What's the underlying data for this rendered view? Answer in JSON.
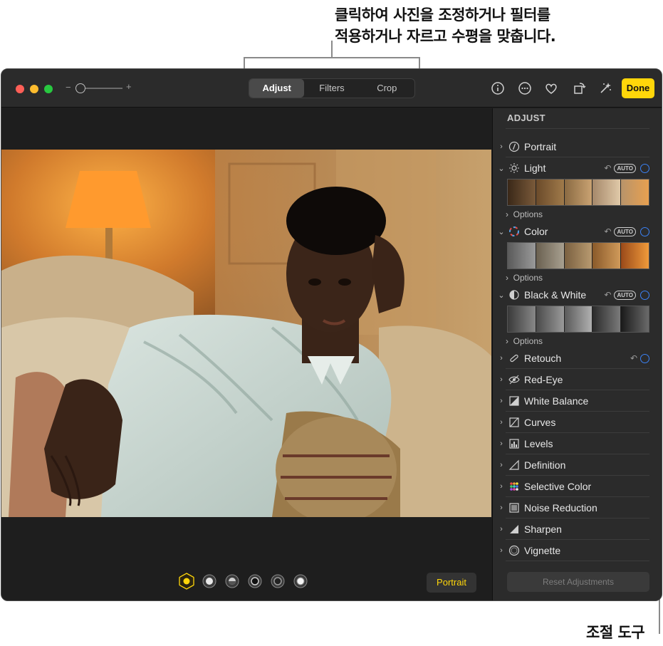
{
  "callouts": {
    "top_line1": "클릭하여 사진을 조정하거나 필터를",
    "top_line2": "적용하거나 자르고 수평을 맞춥니다.",
    "bottom": "조절 도구"
  },
  "toolbar": {
    "zoom_minus": "−",
    "zoom_plus": "+",
    "tabs": [
      {
        "label": "Adjust",
        "active": true
      },
      {
        "label": "Filters",
        "active": false
      },
      {
        "label": "Crop",
        "active": false
      }
    ],
    "icons": [
      "info-icon",
      "more-icon",
      "heart-icon",
      "rotate-icon",
      "auto-enhance-icon"
    ],
    "done_label": "Done",
    "accent": "#ffd60a"
  },
  "canvas": {
    "portrait_label": "Portrait",
    "lighting_options": [
      "natural-light",
      "studio-light",
      "contour-light",
      "stage-light",
      "stage-light-mono",
      "high-key-light-mono"
    ]
  },
  "sidebar": {
    "title": "ADJUST",
    "auto_label": "AUTO",
    "options_label": "Options",
    "items": [
      {
        "label": "Portrait",
        "icon": "portrait-icon",
        "expanded": false
      },
      {
        "label": "Light",
        "icon": "sun-icon",
        "expanded": true
      },
      {
        "label": "Color",
        "icon": "color-wheel-icon",
        "expanded": true
      },
      {
        "label": "Black & White",
        "icon": "half-circle-icon",
        "expanded": true
      },
      {
        "label": "Retouch",
        "icon": "bandage-icon",
        "expanded": false
      },
      {
        "label": "Red-Eye",
        "icon": "eye-icon",
        "expanded": false
      },
      {
        "label": "White Balance",
        "icon": "white-balance-icon",
        "expanded": false
      },
      {
        "label": "Curves",
        "icon": "curves-icon",
        "expanded": false
      },
      {
        "label": "Levels",
        "icon": "levels-icon",
        "expanded": false
      },
      {
        "label": "Definition",
        "icon": "definition-icon",
        "expanded": false
      },
      {
        "label": "Selective Color",
        "icon": "selective-color-icon",
        "expanded": false
      },
      {
        "label": "Noise Reduction",
        "icon": "noise-icon",
        "expanded": false
      },
      {
        "label": "Sharpen",
        "icon": "sharpen-icon",
        "expanded": false
      },
      {
        "label": "Vignette",
        "icon": "vignette-icon",
        "expanded": false
      }
    ],
    "reset_label": "Reset Adjustments",
    "ring_color": "#3b82f6"
  }
}
